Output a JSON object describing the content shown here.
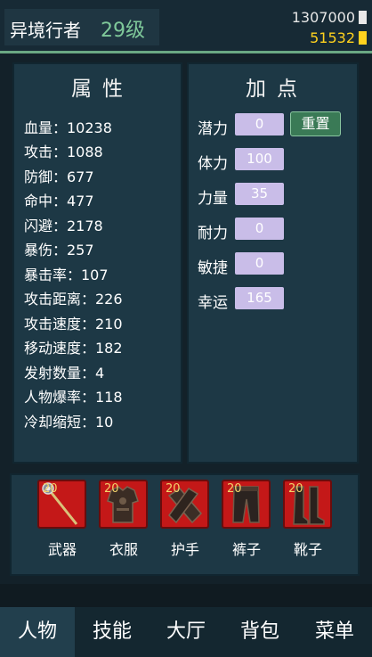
{
  "header": {
    "name": "异境行者",
    "level": "29级",
    "silver": "1307000",
    "gold": "51532"
  },
  "attributes": {
    "title": "属性",
    "rows": [
      "血量：10238",
      "攻击：1088",
      "防御：677",
      "命中：477",
      "闪避：2178",
      "暴伤：257",
      "暴击率：107",
      "攻击距离：226",
      "攻击速度：210",
      "移动速度：182",
      "发射数量：4",
      "人物爆率：118",
      "冷却缩短：10"
    ]
  },
  "points": {
    "title": "加点",
    "reset_label": "重置",
    "rows": [
      {
        "label": "潜力",
        "value": "0"
      },
      {
        "label": "体力",
        "value": "100"
      },
      {
        "label": "力量",
        "value": "35"
      },
      {
        "label": "耐力",
        "value": "0"
      },
      {
        "label": "敏捷",
        "value": "0"
      },
      {
        "label": "幸运",
        "value": "165"
      }
    ]
  },
  "equipment": [
    {
      "label": "武器",
      "level": "20",
      "icon": "staff-icon"
    },
    {
      "label": "衣服",
      "level": "20",
      "icon": "armor-icon"
    },
    {
      "label": "护手",
      "level": "20",
      "icon": "gloves-icon"
    },
    {
      "label": "裤子",
      "level": "20",
      "icon": "pants-icon"
    },
    {
      "label": "靴子",
      "level": "20",
      "icon": "boots-icon"
    }
  ],
  "nav": {
    "tabs": [
      "人物",
      "技能",
      "大厅",
      "背包",
      "菜单"
    ],
    "active": "人物"
  },
  "colors": {
    "level": "#7fc99a",
    "gold": "#ffd21e",
    "slot_bg": "#c41818",
    "point_box": "#c9bde8",
    "reset_button": "#3a7a56"
  }
}
